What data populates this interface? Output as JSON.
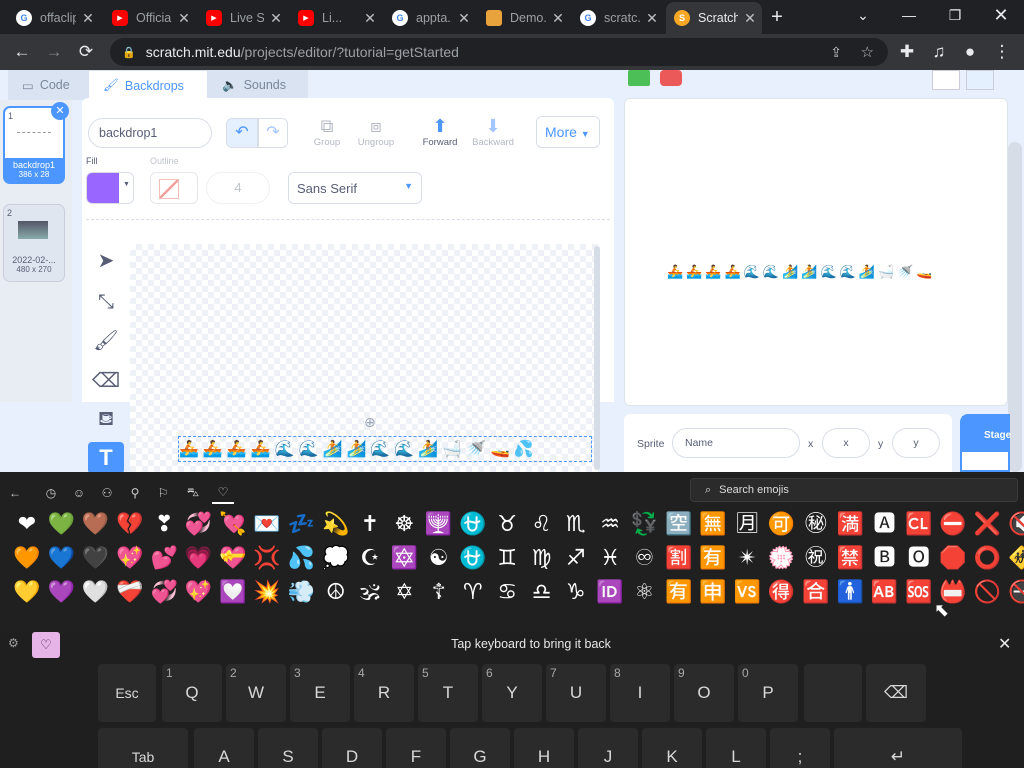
{
  "browser": {
    "tabs": [
      {
        "title": "offaclip...",
        "favicon": "G",
        "color": "#4285f4"
      },
      {
        "title": "Official...",
        "favicon": "yt",
        "color": "#ff0000"
      },
      {
        "title": "Live S...",
        "favicon": "yt",
        "color": "#ff0000"
      },
      {
        "title": "Li...",
        "favicon": "yt",
        "color": "#ff0000"
      },
      {
        "title": "appta...",
        "favicon": "G",
        "color": "#4285f4"
      },
      {
        "title": "Demo...",
        "favicon": "box",
        "color": "#e8a33d"
      },
      {
        "title": "scratc...",
        "favicon": "G",
        "color": "#4285f4"
      },
      {
        "title": "Scratch...",
        "favicon": "S",
        "color": "#f9a825"
      }
    ],
    "url_host": "scratch.mit.edu",
    "url_path": "/projects/editor/?tutorial=getStarted"
  },
  "editor": {
    "tabs": {
      "code": "Code",
      "backdrops": "Backdrops",
      "sounds": "Sounds"
    },
    "costumes": [
      {
        "num": "1",
        "name": "backdrop1",
        "size": "386 x 28"
      },
      {
        "num": "2",
        "name": "2022-02-...",
        "size": "480 x 270"
      }
    ],
    "name_value": "backdrop1",
    "group": "Group",
    "ungroup": "Ungroup",
    "forward": "Forward",
    "backward": "Backward",
    "more": "More",
    "fill": "Fill",
    "outline": "Outline",
    "outline_width": "4",
    "font": "Sans Serif",
    "sprite_label": "Sprite",
    "name_placeholder": "Name",
    "x_label": "x",
    "x_placeholder": "x",
    "y_label": "y",
    "y_placeholder": "y",
    "stage_label": "Stage"
  },
  "emoji_panel": {
    "search_placeholder": "Search emojis",
    "rows": [
      [
        "❤",
        "💚",
        "🤎",
        "💔",
        "❣",
        "💞",
        "💘",
        "💌",
        "💤",
        "💫",
        "✝",
        "☸",
        "🕎",
        "⛎",
        "♉",
        "♌",
        "♏",
        "♒",
        "💱",
        "🈳",
        "🈚",
        "🈷",
        "🉑",
        "㊙",
        "🈵",
        "🅰",
        "🆑",
        "⛔",
        "❌",
        "🔇"
      ],
      [
        "🧡",
        "💙",
        "🖤",
        "💖",
        "💕",
        "💗",
        "💝",
        "💢",
        "💦",
        "💭",
        "☪",
        "🔯",
        "☯",
        "⛎",
        "♊",
        "♍",
        "♐",
        "♓",
        "♾",
        "🈹",
        "🈶",
        "✴",
        "💮",
        "㊗",
        "🈲",
        "🅱",
        "🅾",
        "🛑",
        "⭕",
        "🚸"
      ],
      [
        "💛",
        "💜",
        "🤍",
        "❤️‍🩹",
        "💞",
        "💖",
        "💟",
        "💥",
        "💨",
        "☮",
        "🕉",
        "✡",
        "☦",
        "♈",
        "♋",
        "♎",
        "♑",
        "🆔",
        "⚛",
        "🈶",
        "🈸",
        "🆚",
        "🉐",
        "🈴",
        "🚹",
        "🆎",
        "🆘",
        "📛",
        "🚫",
        "🚭"
      ]
    ]
  },
  "keyboard": {
    "message": "Tap keyboard to bring it back",
    "row1": [
      {
        "label": "Esc"
      },
      {
        "label": "Q",
        "num": "1"
      },
      {
        "label": "W",
        "num": "2"
      },
      {
        "label": "E",
        "num": "3"
      },
      {
        "label": "R",
        "num": "4"
      },
      {
        "label": "T",
        "num": "5"
      },
      {
        "label": "Y",
        "num": "6"
      },
      {
        "label": "U",
        "num": "7"
      },
      {
        "label": "I",
        "num": "8"
      },
      {
        "label": "O",
        "num": "9"
      },
      {
        "label": "P",
        "num": "0"
      },
      {
        "label": ""
      },
      {
        "label": "⌫"
      }
    ],
    "row2": [
      {
        "label": "Tab"
      },
      {
        "label": "A"
      },
      {
        "label": "S"
      },
      {
        "label": "D"
      },
      {
        "label": "F"
      },
      {
        "label": "G"
      },
      {
        "label": "H"
      },
      {
        "label": "J"
      },
      {
        "label": "K"
      },
      {
        "label": "L"
      },
      {
        "label": ";"
      },
      {
        "label": "↵"
      }
    ]
  },
  "colors": {
    "accent": "#4c97ff",
    "fill": "#9966ff"
  }
}
